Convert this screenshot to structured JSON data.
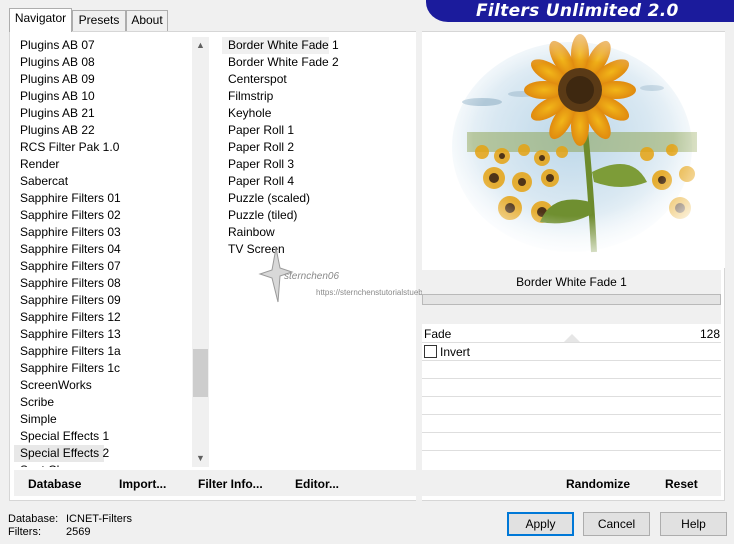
{
  "tabs": [
    {
      "label": "Navigator",
      "active": true
    },
    {
      "label": "Presets",
      "active": false
    },
    {
      "label": "About",
      "active": false
    }
  ],
  "header": {
    "title": "Filters Unlimited 2.0",
    "color": "#1b1b9c"
  },
  "categories": {
    "items": [
      "Plugins AB 07",
      "Plugins AB 08",
      "Plugins AB 09",
      "Plugins AB 10",
      "Plugins AB 21",
      "Plugins AB 22",
      "RCS Filter Pak 1.0",
      "Render",
      "Sabercat",
      "Sapphire Filters 01",
      "Sapphire Filters 02",
      "Sapphire Filters 03",
      "Sapphire Filters 04",
      "Sapphire Filters 07",
      "Sapphire Filters 08",
      "Sapphire Filters 09",
      "Sapphire Filters 12",
      "Sapphire Filters 13",
      "Sapphire Filters 1a",
      "Sapphire Filters 1c",
      "ScreenWorks",
      "Scribe",
      "Simple",
      "Special Effects 1",
      "Special Effects 2",
      "Spot Chromes"
    ],
    "selected_index": 24
  },
  "filters": {
    "items": [
      "Border White Fade 1",
      "Border White Fade 2",
      "Centerspot",
      "Filmstrip",
      "Keyhole",
      "Paper Roll 1",
      "Paper Roll 2",
      "Paper Roll 3",
      "Paper Roll 4",
      "Puzzle (scaled)",
      "Puzzle (tiled)",
      "Rainbow",
      "TV Screen"
    ],
    "selected_index": 0
  },
  "watermark": {
    "text": "sternchen06",
    "url": "https://sternchenstutorialstuebchen.de/"
  },
  "parameters": {
    "filter_name": "Border White Fade 1",
    "fade_label": "Fade",
    "fade_value": "128",
    "invert_label": "Invert",
    "invert_checked": false
  },
  "toolbar": {
    "database": "Database",
    "import": "Import...",
    "filter_info": "Filter Info...",
    "editor": "Editor...",
    "randomize": "Randomize",
    "reset": "Reset"
  },
  "status": {
    "database_label": "Database:",
    "database_value": "ICNET-Filters",
    "filters_label": "Filters:",
    "filters_value": "2569"
  },
  "buttons": {
    "apply": "Apply",
    "cancel": "Cancel",
    "help": "Help"
  }
}
